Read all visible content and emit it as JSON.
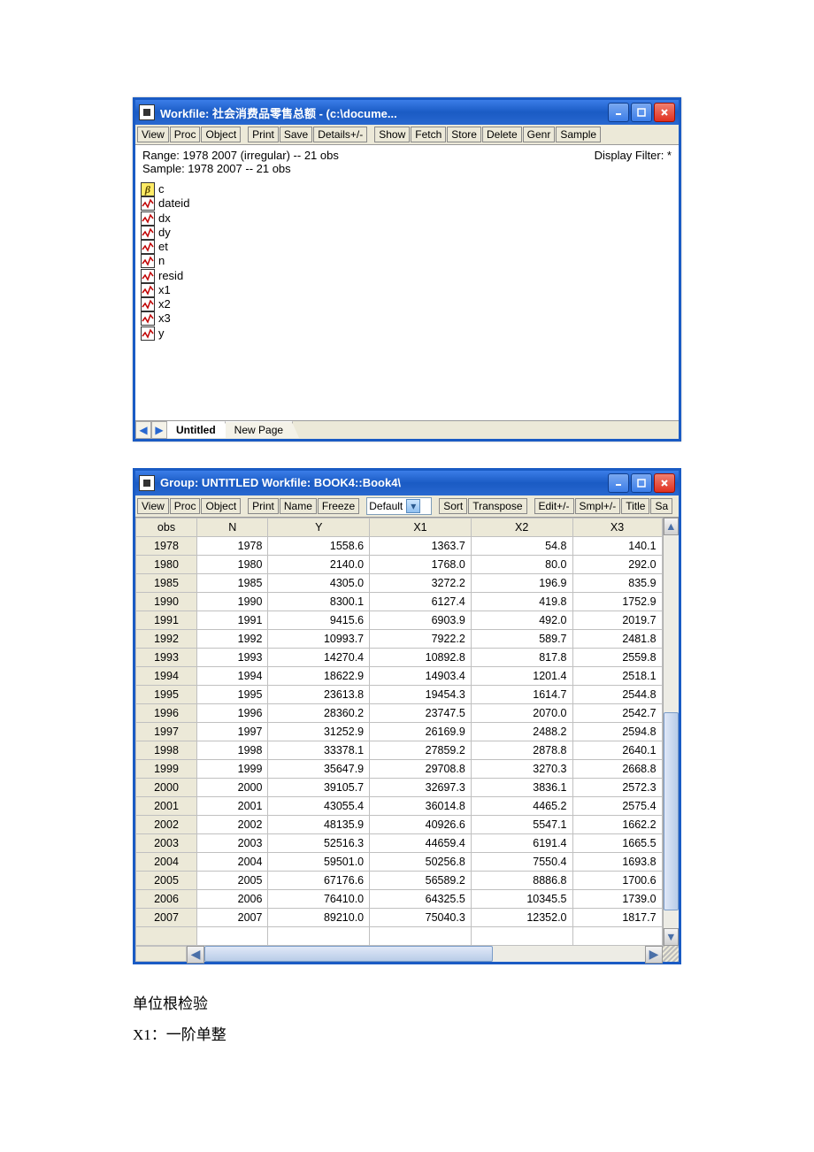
{
  "win1": {
    "title": "Workfile: 社会消费品零售总额 - (c:\\docume...",
    "toolbar": [
      "View",
      "Proc",
      "Object",
      "Print",
      "Save",
      "Details+/-",
      "Show",
      "Fetch",
      "Store",
      "Delete",
      "Genr",
      "Sample"
    ],
    "range": "Range:   1978 2007 (irregular)  --  21 obs",
    "sample": "Sample: 1978 2007  --  21 obs",
    "filter": "Display Filter: *",
    "vars": [
      {
        "type": "coef",
        "name": "c"
      },
      {
        "type": "series",
        "name": "dateid"
      },
      {
        "type": "series",
        "name": "dx"
      },
      {
        "type": "series",
        "name": "dy"
      },
      {
        "type": "series",
        "name": "et"
      },
      {
        "type": "series",
        "name": "n"
      },
      {
        "type": "series",
        "name": "resid"
      },
      {
        "type": "series",
        "name": "x1"
      },
      {
        "type": "series",
        "name": "x2"
      },
      {
        "type": "series",
        "name": "x3"
      },
      {
        "type": "series",
        "name": "y"
      }
    ],
    "tabs": {
      "active": "Untitled",
      "new": "New Page"
    }
  },
  "win2": {
    "title": "Group: UNTITLED    Workfile: BOOK4::Book4\\",
    "toolbar_left": [
      "View",
      "Proc",
      "Object"
    ],
    "toolbar_mid": [
      "Print",
      "Name",
      "Freeze"
    ],
    "select_value": "Default",
    "toolbar_right1": [
      "Sort",
      "Transpose"
    ],
    "toolbar_right2": [
      "Edit+/-",
      "Smpl+/-",
      "Title",
      "Sa"
    ],
    "columns": [
      "obs",
      "N",
      "Y",
      "X1",
      "X2",
      "X3"
    ],
    "rows": [
      [
        "1978",
        "1978",
        "1558.6",
        "1363.7",
        "54.8",
        "140.1"
      ],
      [
        "1980",
        "1980",
        "2140.0",
        "1768.0",
        "80.0",
        "292.0"
      ],
      [
        "1985",
        "1985",
        "4305.0",
        "3272.2",
        "196.9",
        "835.9"
      ],
      [
        "1990",
        "1990",
        "8300.1",
        "6127.4",
        "419.8",
        "1752.9"
      ],
      [
        "1991",
        "1991",
        "9415.6",
        "6903.9",
        "492.0",
        "2019.7"
      ],
      [
        "1992",
        "1992",
        "10993.7",
        "7922.2",
        "589.7",
        "2481.8"
      ],
      [
        "1993",
        "1993",
        "14270.4",
        "10892.8",
        "817.8",
        "2559.8"
      ],
      [
        "1994",
        "1994",
        "18622.9",
        "14903.4",
        "1201.4",
        "2518.1"
      ],
      [
        "1995",
        "1995",
        "23613.8",
        "19454.3",
        "1614.7",
        "2544.8"
      ],
      [
        "1996",
        "1996",
        "28360.2",
        "23747.5",
        "2070.0",
        "2542.7"
      ],
      [
        "1997",
        "1997",
        "31252.9",
        "26169.9",
        "2488.2",
        "2594.8"
      ],
      [
        "1998",
        "1998",
        "33378.1",
        "27859.2",
        "2878.8",
        "2640.1"
      ],
      [
        "1999",
        "1999",
        "35647.9",
        "29708.8",
        "3270.3",
        "2668.8"
      ],
      [
        "2000",
        "2000",
        "39105.7",
        "32697.3",
        "3836.1",
        "2572.3"
      ],
      [
        "2001",
        "2001",
        "43055.4",
        "36014.8",
        "4465.2",
        "2575.4"
      ],
      [
        "2002",
        "2002",
        "48135.9",
        "40926.6",
        "5547.1",
        "1662.2"
      ],
      [
        "2003",
        "2003",
        "52516.3",
        "44659.4",
        "6191.4",
        "1665.5"
      ],
      [
        "2004",
        "2004",
        "59501.0",
        "50256.8",
        "7550.4",
        "1693.8"
      ],
      [
        "2005",
        "2005",
        "67176.6",
        "56589.2",
        "8886.8",
        "1700.6"
      ],
      [
        "2006",
        "2006",
        "76410.0",
        "64325.5",
        "10345.5",
        "1739.0"
      ],
      [
        "2007",
        "2007",
        "89210.0",
        "75040.3",
        "12352.0",
        "1817.7"
      ]
    ]
  },
  "below": {
    "line1": "单位根检验",
    "line2": "X1：一阶单整"
  }
}
